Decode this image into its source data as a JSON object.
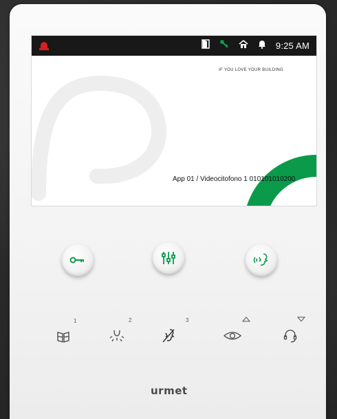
{
  "status_bar": {
    "time": "9:25 AM",
    "icons": [
      "alarm-icon",
      "door-icon",
      "key-icon",
      "home-icon",
      "bell-icon"
    ]
  },
  "screen": {
    "tagline": "IF YOU LOVE YOUR BUILDING",
    "device_label": "App 01 / Videocitofono 1",
    "device_code": "010101010200"
  },
  "buttons": {
    "main": [
      "key-button",
      "settings-button",
      "call-button"
    ],
    "function_keys": [
      {
        "icon": "gate-icon",
        "number": "1"
      },
      {
        "icon": "light-icon",
        "number": "2"
      },
      {
        "icon": "mute-icon",
        "number": "3"
      },
      {
        "icon": "eye-icon",
        "arrow": "up"
      },
      {
        "icon": "headset-icon",
        "arrow": "down"
      }
    ]
  },
  "brand": {
    "logo": "urmet"
  },
  "colors": {
    "accent_green": "#0a9a4a",
    "alarm_red": "#d42020",
    "status_bar_bg": "#181818"
  }
}
